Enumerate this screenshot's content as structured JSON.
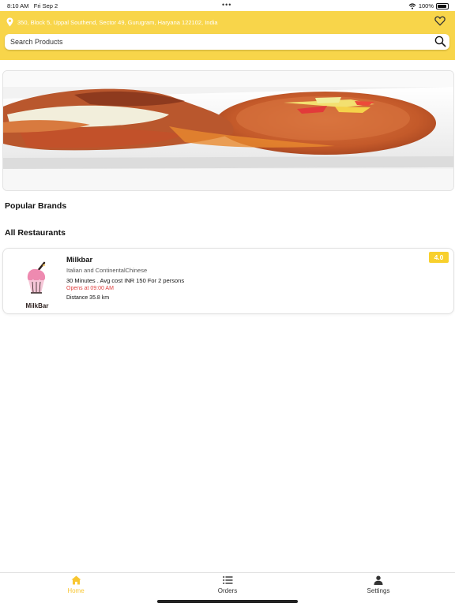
{
  "status_bar": {
    "time": "8:10 AM",
    "date": "Fri Sep 2",
    "battery": "100%"
  },
  "header": {
    "address": "350, Block 5, Uppal Southend, Sector 49, Gurugram, Haryana 122102, India",
    "search_placeholder": "Search Products"
  },
  "sections": {
    "popular_brands": "Popular Brands",
    "all_restaurants": "All Restaurants"
  },
  "restaurant": {
    "logo_text": "MilkBar",
    "name": "Milkbar",
    "cuisine": "Italian and ContinentalChinese",
    "info": "30 Minutes . Avg cost INR 150 For 2 persons",
    "opens": "Opens at 09:00 AM",
    "distance": "Distance 35.8 km",
    "rating": "4.0"
  },
  "tabs": [
    {
      "label": "Home",
      "icon": "home-icon",
      "active": true
    },
    {
      "label": "Orders",
      "icon": "list-icon",
      "active": false
    },
    {
      "label": "Settings",
      "icon": "person-icon",
      "active": false
    }
  ],
  "colors": {
    "accent": "#f8d54a",
    "active_tab": "#f8c630",
    "opens_red": "#e04040"
  }
}
